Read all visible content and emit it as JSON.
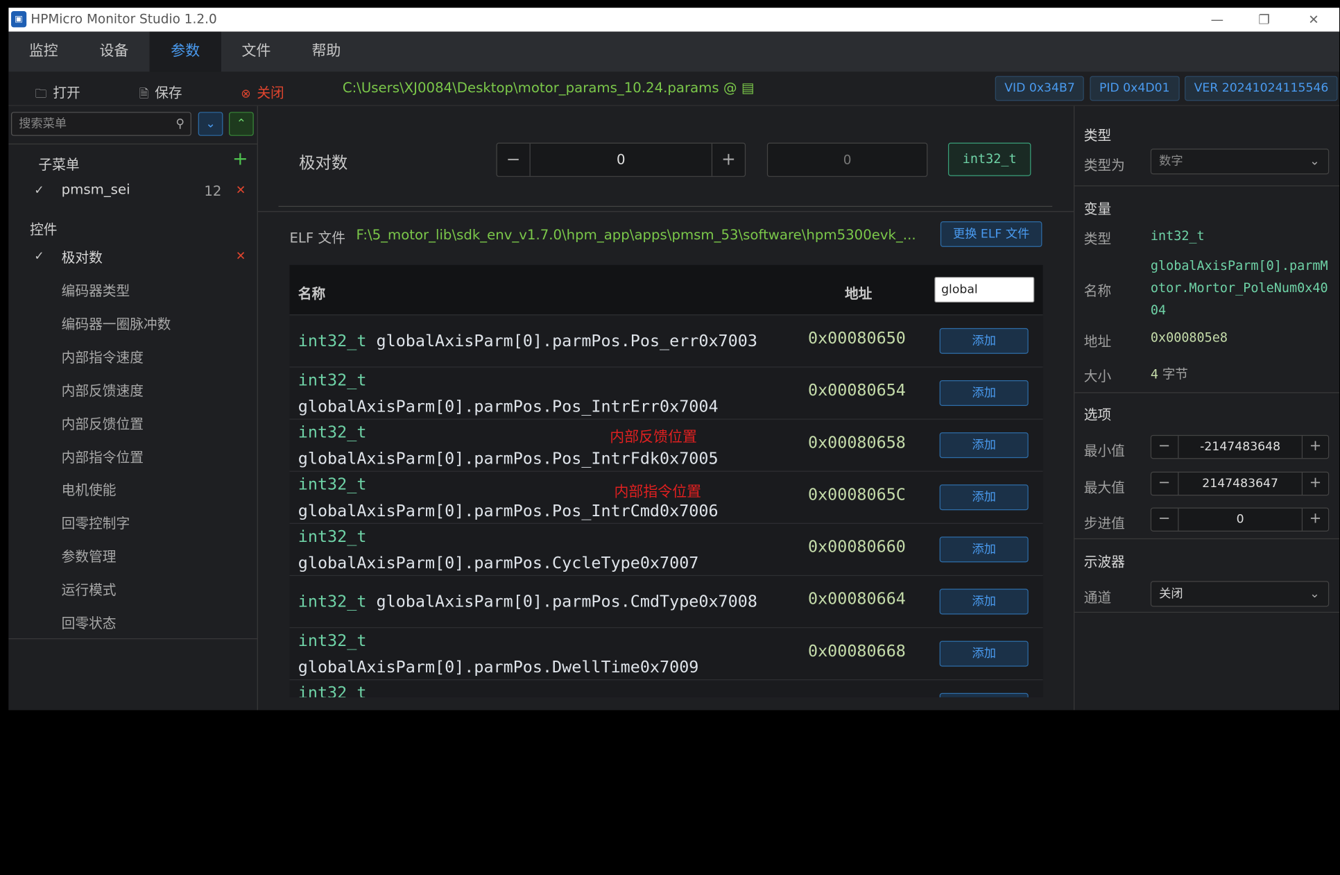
{
  "window": {
    "title": "HPMicro Monitor Studio 1.2.0",
    "icon_text": "HPM"
  },
  "menu": {
    "items": [
      "监控",
      "设备",
      "参数",
      "文件",
      "帮助"
    ],
    "active": "参数"
  },
  "toolbar": {
    "open": "打开",
    "save": "保存",
    "close": "关闭",
    "file_path": "C:\\Users\\XJ0084\\Desktop\\motor_params_10.24.params @",
    "vid": "VID 0x34B7",
    "pid": "PID 0x4D01",
    "ver": "VER 20241024115546"
  },
  "sidebar": {
    "search_placeholder": "搜索菜单",
    "submenu_title": "子菜单",
    "submenu_item": {
      "label": "pmsm_sei",
      "count": "12"
    },
    "controls_title": "控件",
    "items": [
      "极对数",
      "编码器类型",
      "编码器一圈脉冲数",
      "内部指令速度",
      "内部反馈速度",
      "内部反馈位置",
      "内部指令位置",
      "电机使能",
      "回零控制字",
      "参数管理",
      "运行模式",
      "回零状态"
    ]
  },
  "param": {
    "label": "极对数",
    "value": "0",
    "readback": "0",
    "type_tag": "int32_t"
  },
  "elf": {
    "label": "ELF 文件",
    "path": "F:\\5_motor_lib\\sdk_env_v1.7.0\\hpm_app\\apps\\pmsm_53\\software\\hpm5300evk_...",
    "change_button": "更换 ELF 文件"
  },
  "table": {
    "col_name": "名称",
    "col_addr": "地址",
    "filter_value": "global",
    "add_label": "添加",
    "rows": [
      {
        "type": "int32_t",
        "name": "globalAxisParm[0].parmPos.Pos_err0x7003",
        "addr": "0x00080650",
        "wrap": false
      },
      {
        "type": "int32_t",
        "name": "globalAxisParm[0].parmPos.Pos_IntrErr0x7004",
        "addr": "0x00080654",
        "wrap": true
      },
      {
        "type": "int32_t",
        "name": "globalAxisParm[0].parmPos.Pos_IntrFdk0x7005",
        "addr": "0x00080658",
        "wrap": true
      },
      {
        "type": "int32_t",
        "name": "globalAxisParm[0].parmPos.Pos_IntrCmd0x7006",
        "addr": "0x0008065C",
        "wrap": true
      },
      {
        "type": "int32_t",
        "name": "globalAxisParm[0].parmPos.CycleType0x7007",
        "addr": "0x00080660",
        "wrap": true
      },
      {
        "type": "int32_t",
        "name": "globalAxisParm[0].parmPos.CmdType0x7008",
        "addr": "0x00080664",
        "wrap": false
      },
      {
        "type": "int32_t",
        "name": "globalAxisParm[0].parmPos.DwellTime0x7009",
        "addr": "0x00080668",
        "wrap": true
      },
      {
        "type": "int32_t",
        "name": "",
        "addr": "",
        "wrap": true
      }
    ],
    "annotations": [
      "内部反馈位置",
      "内部指令位置"
    ]
  },
  "panel": {
    "type_section": "类型",
    "type_as_label": "类型为",
    "type_as_value": "数字",
    "var_section": "变量",
    "var_type_label": "类型",
    "var_type_value": "int32_t",
    "var_name_label": "名称",
    "var_name_value": "globalAxisParm[0].parmMotor.Mortor_PoleNum0x4004",
    "var_addr_label": "地址",
    "var_addr_value": "0x000805e8",
    "var_size_label": "大小",
    "var_size_num": "4",
    "var_size_unit": "字节",
    "opt_section": "选项",
    "min_label": "最小值",
    "min_value": "-2147483648",
    "max_label": "最大值",
    "max_value": "2147483647",
    "step_label": "步进值",
    "step_value": "0",
    "scope_section": "示波器",
    "channel_label": "通道",
    "channel_value": "关闭"
  },
  "colors": {
    "accent": "#4a9bf0",
    "path_green": "#7bc84a",
    "type_green": "#6fd3a7",
    "close_red": "#e0452e",
    "annot_red": "#e02020"
  }
}
